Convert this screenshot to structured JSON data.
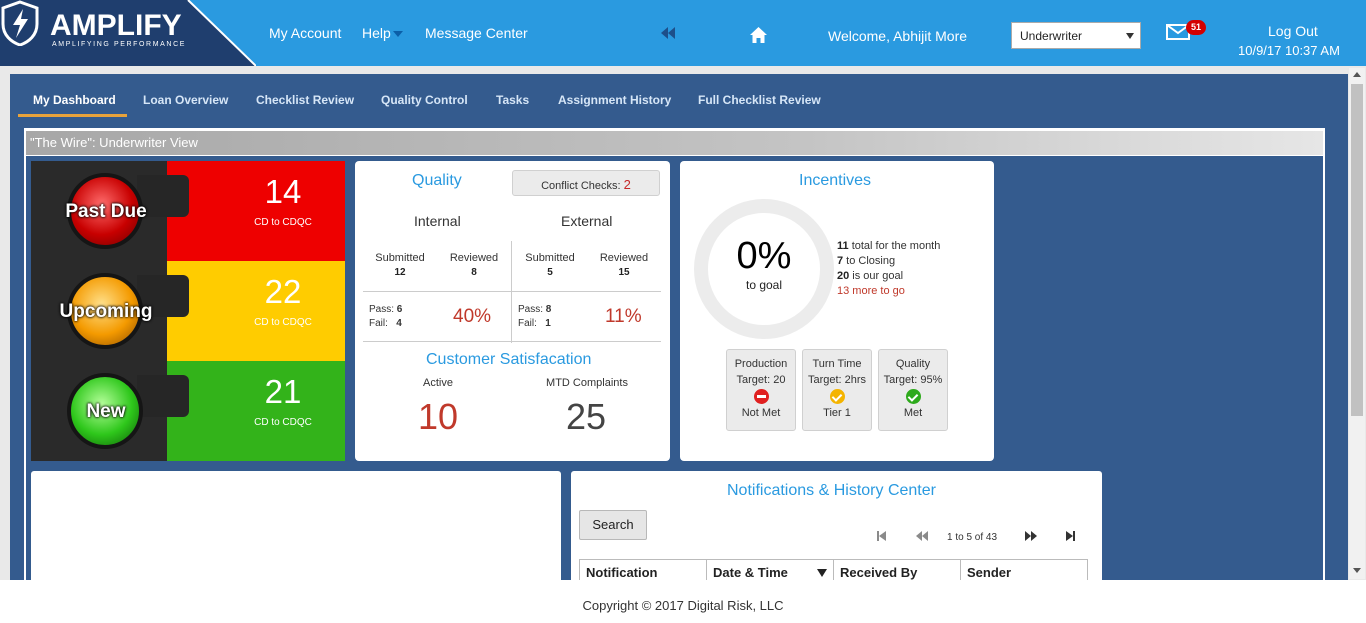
{
  "header": {
    "logo_text": "AMPLIFY",
    "logo_tagline": "AMPLIFYING PERFORMANCE",
    "nav": {
      "my_account": "My Account",
      "help": "Help",
      "message_center": "Message Center"
    },
    "welcome": "Welcome, Abhijit More",
    "role_select_value": "Underwriter",
    "mail_badge": "51",
    "logout": "Log Out",
    "datetime": "10/9/17 10:37 AM"
  },
  "tabs": [
    "My Dashboard",
    "Loan Overview",
    "Checklist Review",
    "Quality Control",
    "Tasks",
    "Assignment History",
    "Full Checklist Review"
  ],
  "view_title": "\"The Wire\": Underwriter View",
  "traffic_lights": [
    {
      "label": "Past Due",
      "count": "14",
      "sub": "CD to CDQC",
      "color": "#ee0000"
    },
    {
      "label": "Upcoming",
      "count": "22",
      "sub": "CD to CDQC",
      "color": "#ffcc00"
    },
    {
      "label": "New",
      "count": "21",
      "sub": "CD to CDQC",
      "color": "#33b31a"
    }
  ],
  "quality": {
    "title": "Quality",
    "conflict_label": "Conflict Checks:",
    "conflict_value": "2",
    "internal": {
      "label": "Internal",
      "submitted_label": "Submitted",
      "submitted": "12",
      "reviewed_label": "Reviewed",
      "reviewed": "8",
      "pass_label": "Pass:",
      "pass": "6",
      "fail_label": "Fail:",
      "fail": "4",
      "pct": "40%"
    },
    "external": {
      "label": "External",
      "submitted_label": "Submitted",
      "submitted": "5",
      "reviewed_label": "Reviewed",
      "reviewed": "15",
      "pass_label": "Pass:",
      "pass": "8",
      "fail_label": "Fail:",
      "fail": "1",
      "pct": "11%"
    },
    "cs_title": "Customer Satisfacation",
    "active_label": "Active",
    "active": "10",
    "mtd_label": "MTD Complaints",
    "mtd": "25"
  },
  "incentives": {
    "title": "Incentives",
    "pct": "0%",
    "pct_sub": "to goal",
    "lines": [
      {
        "num": "11",
        "text": " total for the month"
      },
      {
        "num": "7",
        "text": " to Closing"
      },
      {
        "num": "20",
        "text": " is our goal"
      },
      {
        "num": "13",
        "text": " more to go"
      }
    ],
    "tiles": [
      {
        "name": "Production",
        "target": "Target: 20",
        "status": "Not Met",
        "icon": "minus-circle-icon"
      },
      {
        "name": "Turn Time",
        "target": "Target: 2hrs",
        "status": "Tier 1",
        "icon": "check-circle-icon"
      },
      {
        "name": "Quality",
        "target": "Target: 95%",
        "status": "Met",
        "icon": "check-circle-icon"
      }
    ]
  },
  "notifications": {
    "title": "Notifications & History Center",
    "search": "Search",
    "pager": "1 to 5 of 43",
    "columns": [
      "Notification",
      "Date & Time",
      "Received By",
      "Sender"
    ]
  },
  "footer": "Copyright © 2017 Digital Risk, LLC"
}
